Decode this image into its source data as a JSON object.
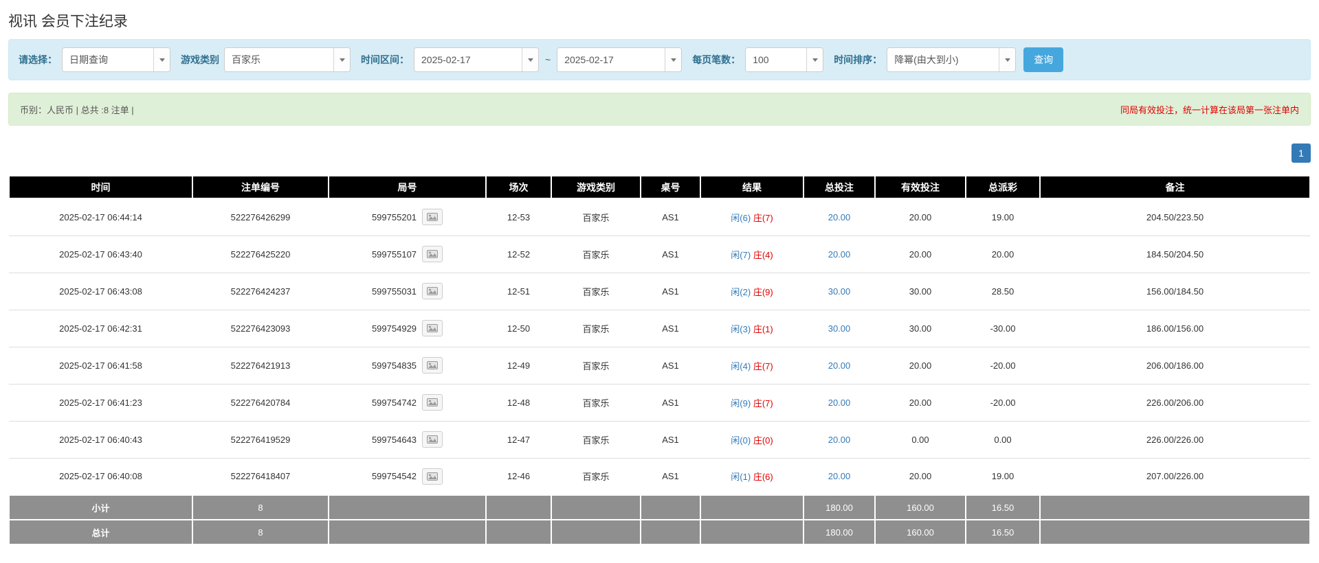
{
  "page": {
    "title": "视讯 会员下注纪录"
  },
  "toolbar": {
    "select_label": "请选择：",
    "select_value": "日期查询",
    "game_label": "游戏类别",
    "game_value": "百家乐",
    "range_label": "时间区间：",
    "date_from": "2025-02-17",
    "range_separator": "~",
    "date_to": "2025-02-17",
    "page_size_label": "每页笔数：",
    "page_size_value": "100",
    "sort_label": "时间排序：",
    "sort_value": "降幂(由大到小)",
    "search_label": "查询"
  },
  "summary_bar": {
    "left_text": "币别：人民币 | 总共 :8 注单 |",
    "right_text": "同局有效投注，统一计算在该局第一张注单内"
  },
  "pagination": {
    "page": "1"
  },
  "table": {
    "headers": [
      "时间",
      "注单编号",
      "局号",
      "场次",
      "游戏类别",
      "桌号",
      "结果",
      "总投注",
      "有效投注",
      "总派彩",
      "备注"
    ],
    "rows": [
      {
        "time": "2025-02-17 06:44:14",
        "bet_id": "522276426299",
        "round_id": "599755201",
        "session": "12-53",
        "game": "百家乐",
        "table_no": "AS1",
        "result_player": "闲(6)",
        "result_banker": "庄(7)",
        "total_bet": "20.00",
        "valid_bet": "20.00",
        "payout": "19.00",
        "remark": "204.50/223.50"
      },
      {
        "time": "2025-02-17 06:43:40",
        "bet_id": "522276425220",
        "round_id": "599755107",
        "session": "12-52",
        "game": "百家乐",
        "table_no": "AS1",
        "result_player": "闲(7)",
        "result_banker": "庄(4)",
        "total_bet": "20.00",
        "valid_bet": "20.00",
        "payout": "20.00",
        "remark": "184.50/204.50"
      },
      {
        "time": "2025-02-17 06:43:08",
        "bet_id": "522276424237",
        "round_id": "599755031",
        "session": "12-51",
        "game": "百家乐",
        "table_no": "AS1",
        "result_player": "闲(2)",
        "result_banker": "庄(9)",
        "total_bet": "30.00",
        "valid_bet": "30.00",
        "payout": "28.50",
        "remark": "156.00/184.50"
      },
      {
        "time": "2025-02-17 06:42:31",
        "bet_id": "522276423093",
        "round_id": "599754929",
        "session": "12-50",
        "game": "百家乐",
        "table_no": "AS1",
        "result_player": "闲(3)",
        "result_banker": "庄(1)",
        "total_bet": "30.00",
        "valid_bet": "30.00",
        "payout": "-30.00",
        "remark": "186.00/156.00"
      },
      {
        "time": "2025-02-17 06:41:58",
        "bet_id": "522276421913",
        "round_id": "599754835",
        "session": "12-49",
        "game": "百家乐",
        "table_no": "AS1",
        "result_player": "闲(4)",
        "result_banker": "庄(7)",
        "total_bet": "20.00",
        "valid_bet": "20.00",
        "payout": "-20.00",
        "remark": "206.00/186.00"
      },
      {
        "time": "2025-02-17 06:41:23",
        "bet_id": "522276420784",
        "round_id": "599754742",
        "session": "12-48",
        "game": "百家乐",
        "table_no": "AS1",
        "result_player": "闲(9)",
        "result_banker": "庄(7)",
        "total_bet": "20.00",
        "valid_bet": "20.00",
        "payout": "-20.00",
        "remark": "226.00/206.00"
      },
      {
        "time": "2025-02-17 06:40:43",
        "bet_id": "522276419529",
        "round_id": "599754643",
        "session": "12-47",
        "game": "百家乐",
        "table_no": "AS1",
        "result_player": "闲(0)",
        "result_banker": "庄(0)",
        "total_bet": "20.00",
        "valid_bet": "0.00",
        "payout": "0.00",
        "remark": "226.00/226.00"
      },
      {
        "time": "2025-02-17 06:40:08",
        "bet_id": "522276418407",
        "round_id": "599754542",
        "session": "12-46",
        "game": "百家乐",
        "table_no": "AS1",
        "result_player": "闲(1)",
        "result_banker": "庄(6)",
        "total_bet": "20.00",
        "valid_bet": "20.00",
        "payout": "19.00",
        "remark": "207.00/226.00"
      }
    ],
    "subtotal": {
      "label": "小计",
      "count": "8",
      "total_bet": "180.00",
      "valid_bet": "160.00",
      "payout": "16.50"
    },
    "grand_total": {
      "label": "总计",
      "count": "8",
      "total_bet": "180.00",
      "valid_bet": "160.00",
      "payout": "16.50"
    }
  },
  "colors": {
    "accent": "#337ab7",
    "player_blue": "#337ab7",
    "banker_red": "#e00000",
    "negative_red": "#e00000",
    "notice_red": "#e00000",
    "filter_bg": "#d9edf7",
    "filter_border": "#cde8f4",
    "filter_label": "#31708f",
    "summary_bg": "#dff0d8",
    "summary_border": "#d6e9c6",
    "summary_text": "#555555",
    "header_bg": "#000000",
    "footer_bg": "#8f8f8f",
    "search_button_bg": "#45a7dd",
    "pagination_bg": "#337ab7"
  }
}
